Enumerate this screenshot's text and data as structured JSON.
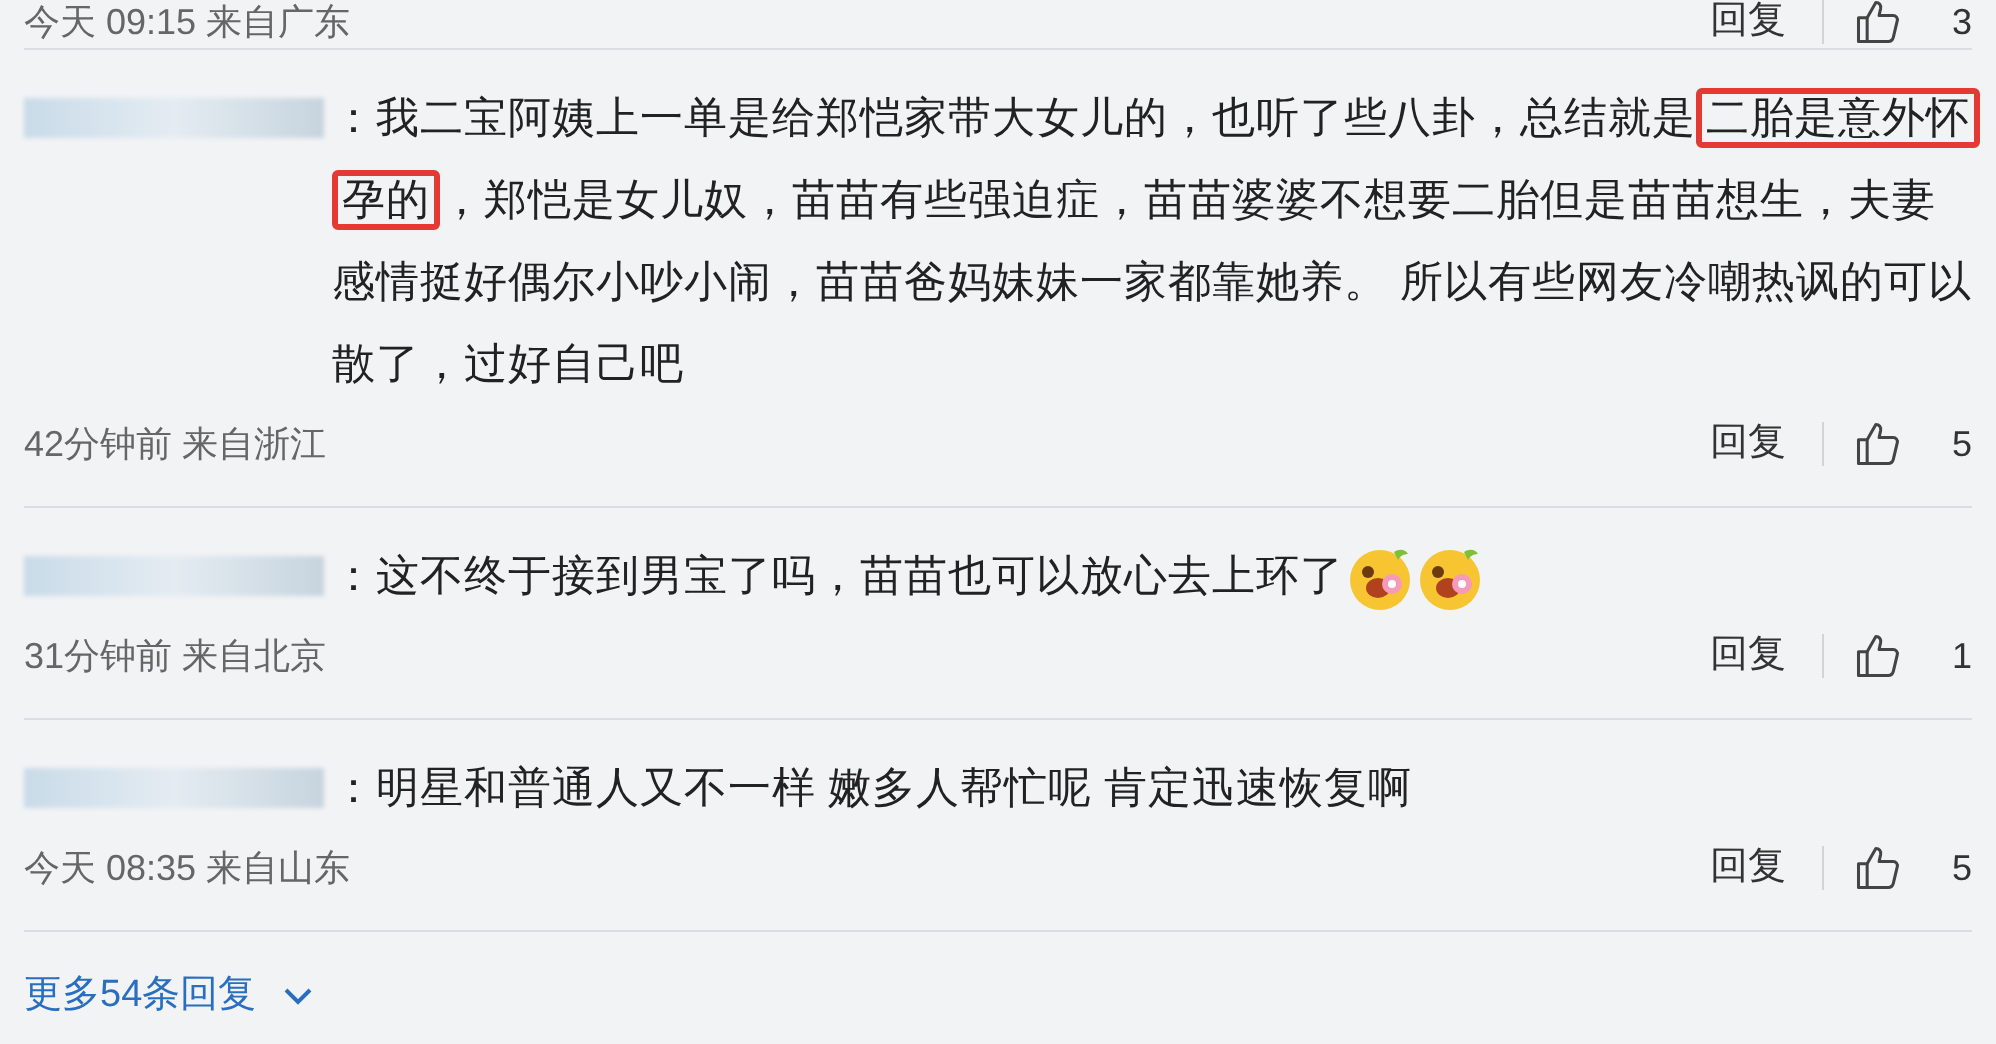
{
  "comments": [
    {
      "kind": "cut",
      "meta": "今天 09:15 来自广东",
      "reply": "回复",
      "likes": "3"
    },
    {
      "kind": "full",
      "segments": [
        {
          "text": "：我二宝阿姨上一单是给郑恺家带大女儿的，也听了些八卦，总结就是",
          "highlighted": false
        },
        {
          "text": "二胎是意外怀孕的",
          "highlighted": true
        },
        {
          "text": "，郑恺是女儿奴，苗苗有些强迫症，苗苗婆婆不想要二胎但是苗苗想生，夫妻感情挺好偶尔小吵小闹，苗苗爸妈妹妹一家都靠她养。 所以有些网友冷嘲热讽的可以散了，过好自己吧",
          "highlighted": false
        }
      ],
      "meta": "42分钟前 来自浙江",
      "reply": "回复",
      "likes": "5"
    },
    {
      "kind": "full",
      "segments": [
        {
          "text": "：这不终于接到男宝了吗，苗苗也可以放心去上环了",
          "highlighted": false
        }
      ],
      "emojis": [
        {
          "kind": "picture"
        },
        {
          "kind": "picture"
        }
      ],
      "meta": "31分钟前 来自北京",
      "reply": "回复",
      "likes": "1"
    },
    {
      "kind": "full",
      "segments": [
        {
          "text": "：明星和普通人又不一样 嫩多人帮忙呢 肯定迅速恢复啊",
          "highlighted": false
        }
      ],
      "meta": "今天 08:35 来自山东",
      "reply": "回复",
      "likes": "5"
    }
  ],
  "more_replies": "更多54条回复"
}
